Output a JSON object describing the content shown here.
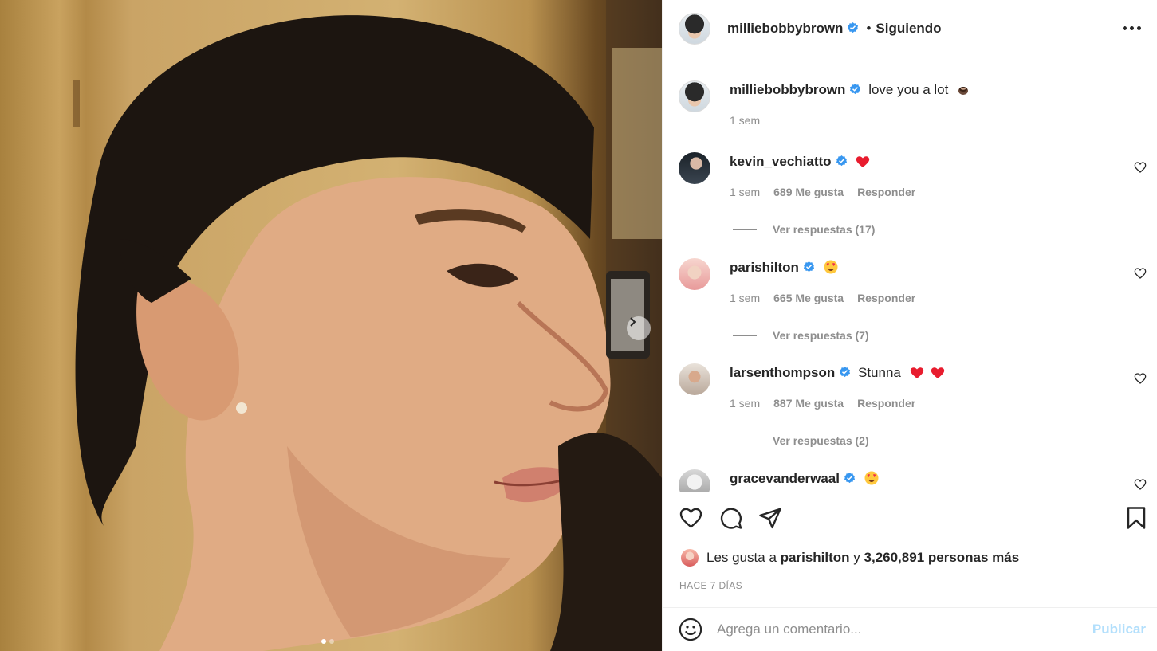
{
  "post": {
    "username": "milliebobbybrown",
    "separator": "•",
    "follow_status": "Siguiendo",
    "caption": "love you a lot",
    "caption_time": "1 sem"
  },
  "comments": [
    {
      "username": "kevin_vechiatto",
      "text": "",
      "emoji": "red-heart",
      "time": "1 sem",
      "likes": "689 Me gusta",
      "reply": "Responder",
      "view_replies": "Ver respuestas (17)"
    },
    {
      "username": "parishilton",
      "text": "",
      "emoji": "heart-eyes",
      "time": "1 sem",
      "likes": "665 Me gusta",
      "reply": "Responder",
      "view_replies": "Ver respuestas (7)"
    },
    {
      "username": "larsenthompson",
      "text": "Stunna",
      "emoji": "two-red-hearts",
      "time": "1 sem",
      "likes": "887 Me gusta",
      "reply": "Responder",
      "view_replies": "Ver respuestas (2)"
    },
    {
      "username": "gracevanderwaal",
      "text": "",
      "emoji": "heart-eyes"
    }
  ],
  "likes_line": {
    "prefix": "Les gusta a",
    "user": "parishilton",
    "connector": "y",
    "count": "3,260,891 personas más"
  },
  "post_date": "HACE 7 DÍAS",
  "add_comment": {
    "placeholder": "Agrega un comentario...",
    "publish": "Publicar"
  },
  "carousel": {
    "current": 1,
    "total": 2
  },
  "colors": {
    "verified_blue": "#3897f0",
    "heart_red": "#ed4956",
    "publish_disabled": "#b2dffc",
    "muted_text": "#8e8e8e"
  }
}
